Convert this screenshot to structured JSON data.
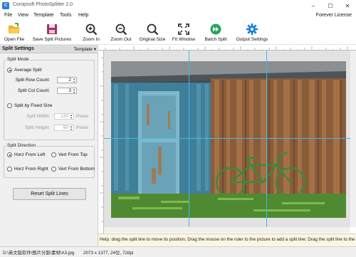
{
  "window": {
    "title": "Coropsoft PhotoSplitter 2.0",
    "minimize_glyph": "–",
    "maximize_glyph": "☐",
    "close_glyph": "✕"
  },
  "menu": {
    "items": [
      "File",
      "View",
      "Template",
      "Tools",
      "Help"
    ],
    "license": "Forever License"
  },
  "toolbar": {
    "buttons": [
      {
        "label": "Open File",
        "icon": "folder-open-icon",
        "color": "#f2b01e"
      },
      {
        "label": "Save Split Pictures",
        "icon": "save-icon",
        "color": "#a0306a"
      },
      {
        "label": "Zoom In",
        "icon": "zoom-in-icon",
        "color": "#2b2b2b"
      },
      {
        "label": "Zoom Out",
        "icon": "zoom-out-icon",
        "color": "#2b2b2b"
      },
      {
        "label": "Original Size",
        "icon": "original-size-icon",
        "color": "#2b2b2b"
      },
      {
        "label": "Fit Window",
        "icon": "fit-window-icon",
        "color": "#2b2b2b"
      },
      {
        "label": "Batch Split",
        "icon": "batch-split-icon",
        "color": "#26a65b"
      },
      {
        "label": "Output Settings",
        "icon": "gear-icon",
        "color": "#1e7fd6"
      }
    ]
  },
  "panel": {
    "title": "Split Settings",
    "template_label": "Template ▾",
    "split_mode": {
      "title": "Split Mode",
      "average_label": "Average Split",
      "average_selected": true,
      "row_count_label": "Split Row Count:",
      "row_count": "2",
      "col_count_label": "Split Col Count:",
      "col_count": "3",
      "fixed_label": "Split by Fixed Size",
      "width_label": "Split Width:",
      "width_value": "120",
      "height_label": "Split Height:",
      "height_value": "90",
      "unit": "Pixels"
    },
    "split_direction": {
      "title": "Split Direction",
      "options": [
        "Horz From Left",
        "Vert From Top",
        "Horz From Right",
        "Vert From Bottom"
      ],
      "selected": "Horz From Left"
    },
    "reset_label": "Reset Split Lines"
  },
  "help_text": "Help: drag the split line to move its position; Drag the mouse on the ruler to the picture to add a split line; Drag the split line to the ruler to delete it",
  "status": {
    "path": "D:\\英文版软件\\图片分割\\素材\\A3.jpg",
    "info": "2073 x 1377, 24位, 72dpi"
  },
  "colors": {
    "split_line": "#41b8e8",
    "accent": "#1e7fd6"
  }
}
